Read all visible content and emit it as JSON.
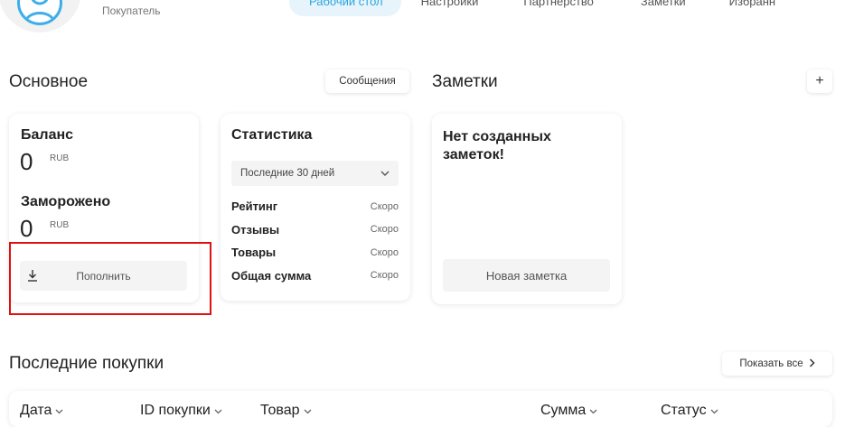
{
  "header": {
    "role": "Покупатель",
    "nav": [
      {
        "label": "Рабочий стол",
        "active": true
      },
      {
        "label": "Настройки",
        "active": false
      },
      {
        "label": "Партнерство",
        "active": false
      },
      {
        "label": "Заметки",
        "active": false
      },
      {
        "label": "Избранн",
        "active": false
      }
    ]
  },
  "main": {
    "title": "Основное",
    "messages_button": "Сообщения"
  },
  "balance_card": {
    "balance_title": "Баланс",
    "balance_value": "0",
    "balance_unit": "RUB",
    "frozen_title": "Заморожено",
    "frozen_value": "0",
    "frozen_unit": "RUB",
    "topup_button": "Пополнить"
  },
  "stats_card": {
    "title": "Статистика",
    "period": "Последние 30 дней",
    "rows": [
      {
        "label": "Рейтинг",
        "value": "Скоро"
      },
      {
        "label": "Отзывы",
        "value": "Скоро"
      },
      {
        "label": "Товары",
        "value": "Скоро"
      },
      {
        "label": "Общая сумма",
        "value": "Скоро"
      }
    ]
  },
  "notes": {
    "title": "Заметки",
    "add_button": "+",
    "empty_text": "Нет созданных заметок!",
    "new_note_button": "Новая заметка"
  },
  "purchases": {
    "title": "Последние покупки",
    "show_all_button": "Показать все",
    "columns": [
      "Дата",
      "ID покупки",
      "Товар",
      "Сумма",
      "Статус"
    ]
  },
  "colors": {
    "accent": "#2aa6e0",
    "highlight": "#e01010"
  }
}
